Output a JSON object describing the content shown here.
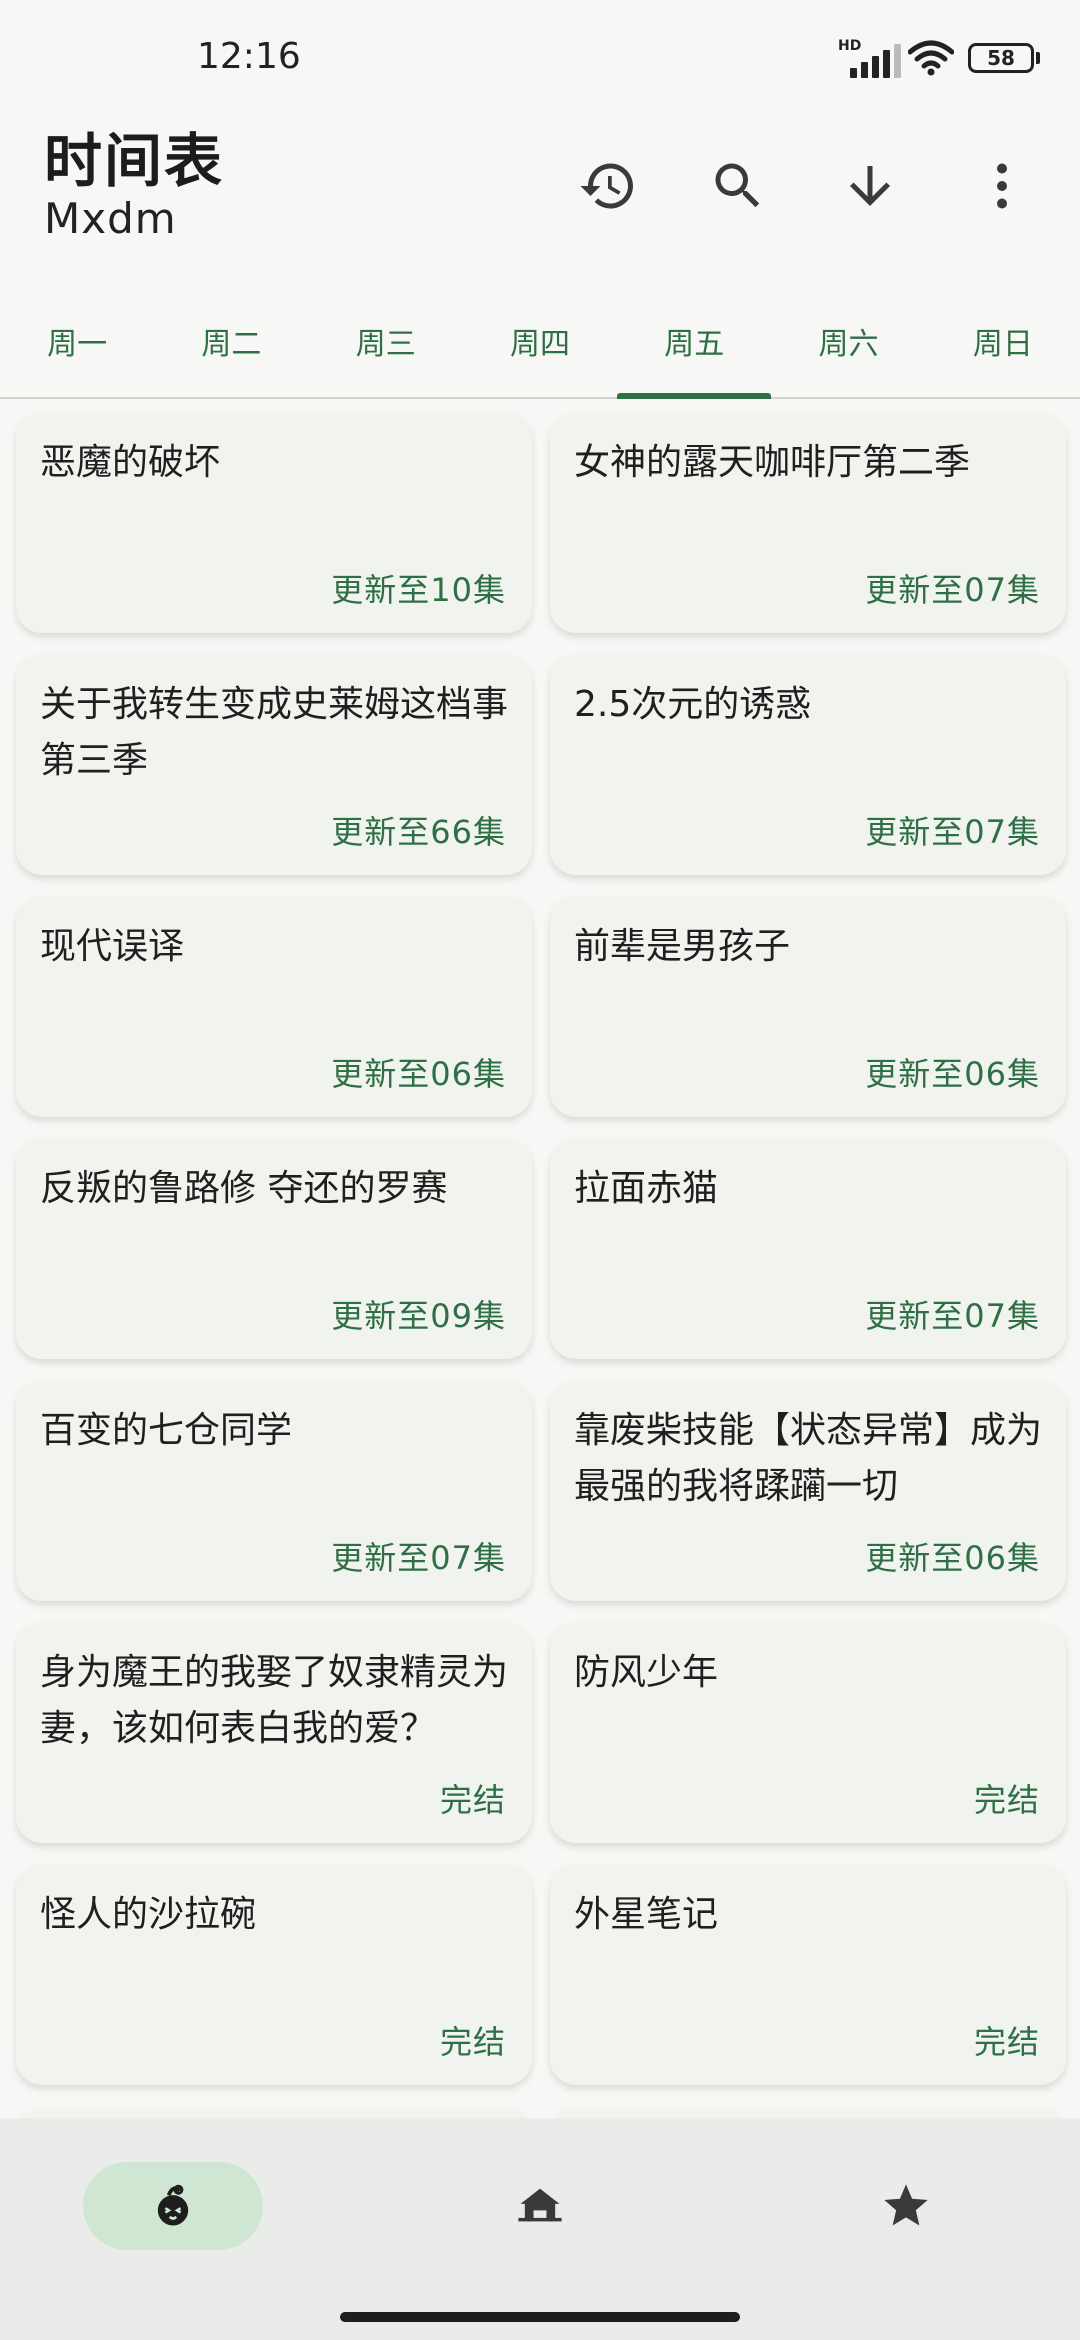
{
  "status_bar": {
    "time": "12:16",
    "network": "HD",
    "battery": "58"
  },
  "app_bar": {
    "title": "时间表",
    "subtitle": "Mxdm",
    "actions": [
      "history-icon",
      "search-icon",
      "download-icon",
      "more-vert-icon"
    ]
  },
  "tabs": [
    {
      "label": "周一"
    },
    {
      "label": "周二"
    },
    {
      "label": "周三"
    },
    {
      "label": "周四"
    },
    {
      "label": "周五"
    },
    {
      "label": "周六"
    },
    {
      "label": "周日"
    }
  ],
  "active_tab": "周五",
  "cards": [
    {
      "title": "恶魔的破坏",
      "status": "更新至10集"
    },
    {
      "title": "女神的露天咖啡厅第二季",
      "status": "更新至07集"
    },
    {
      "title": "关于我转生变成史莱姆这档事第三季",
      "status": "更新至66集"
    },
    {
      "title": "2.5次元的诱惑",
      "status": "更新至07集"
    },
    {
      "title": "现代误译",
      "status": "更新至06集"
    },
    {
      "title": "前辈是男孩子",
      "status": "更新至06集"
    },
    {
      "title": "反叛的鲁路修 夺还的罗赛",
      "status": "更新至09集"
    },
    {
      "title": "拉面赤猫",
      "status": "更新至07集"
    },
    {
      "title": "百变的七仓同学",
      "status": "更新至07集"
    },
    {
      "title": "靠废柴技能【状态异常】成为最强的我将蹂躏一切",
      "status": "更新至06集"
    },
    {
      "title": "身为魔王的我娶了奴隶精灵为妻，该如何表白我的爱？",
      "status": "完结"
    },
    {
      "title": "防风少年",
      "status": "完结"
    },
    {
      "title": "怪人的沙拉碗",
      "status": "完结"
    },
    {
      "title": "外星笔记",
      "status": "完结"
    }
  ],
  "bottom_nav": [
    {
      "icon": "mascot-icon",
      "active": true
    },
    {
      "icon": "home-icon",
      "active": false
    },
    {
      "icon": "star-icon",
      "active": false
    }
  ],
  "colors": {
    "accent": "#2f6f45",
    "card_bg": "#f1f3ef",
    "nav_active": "#cfe6d3",
    "nav_bg": "#e9ece8"
  }
}
